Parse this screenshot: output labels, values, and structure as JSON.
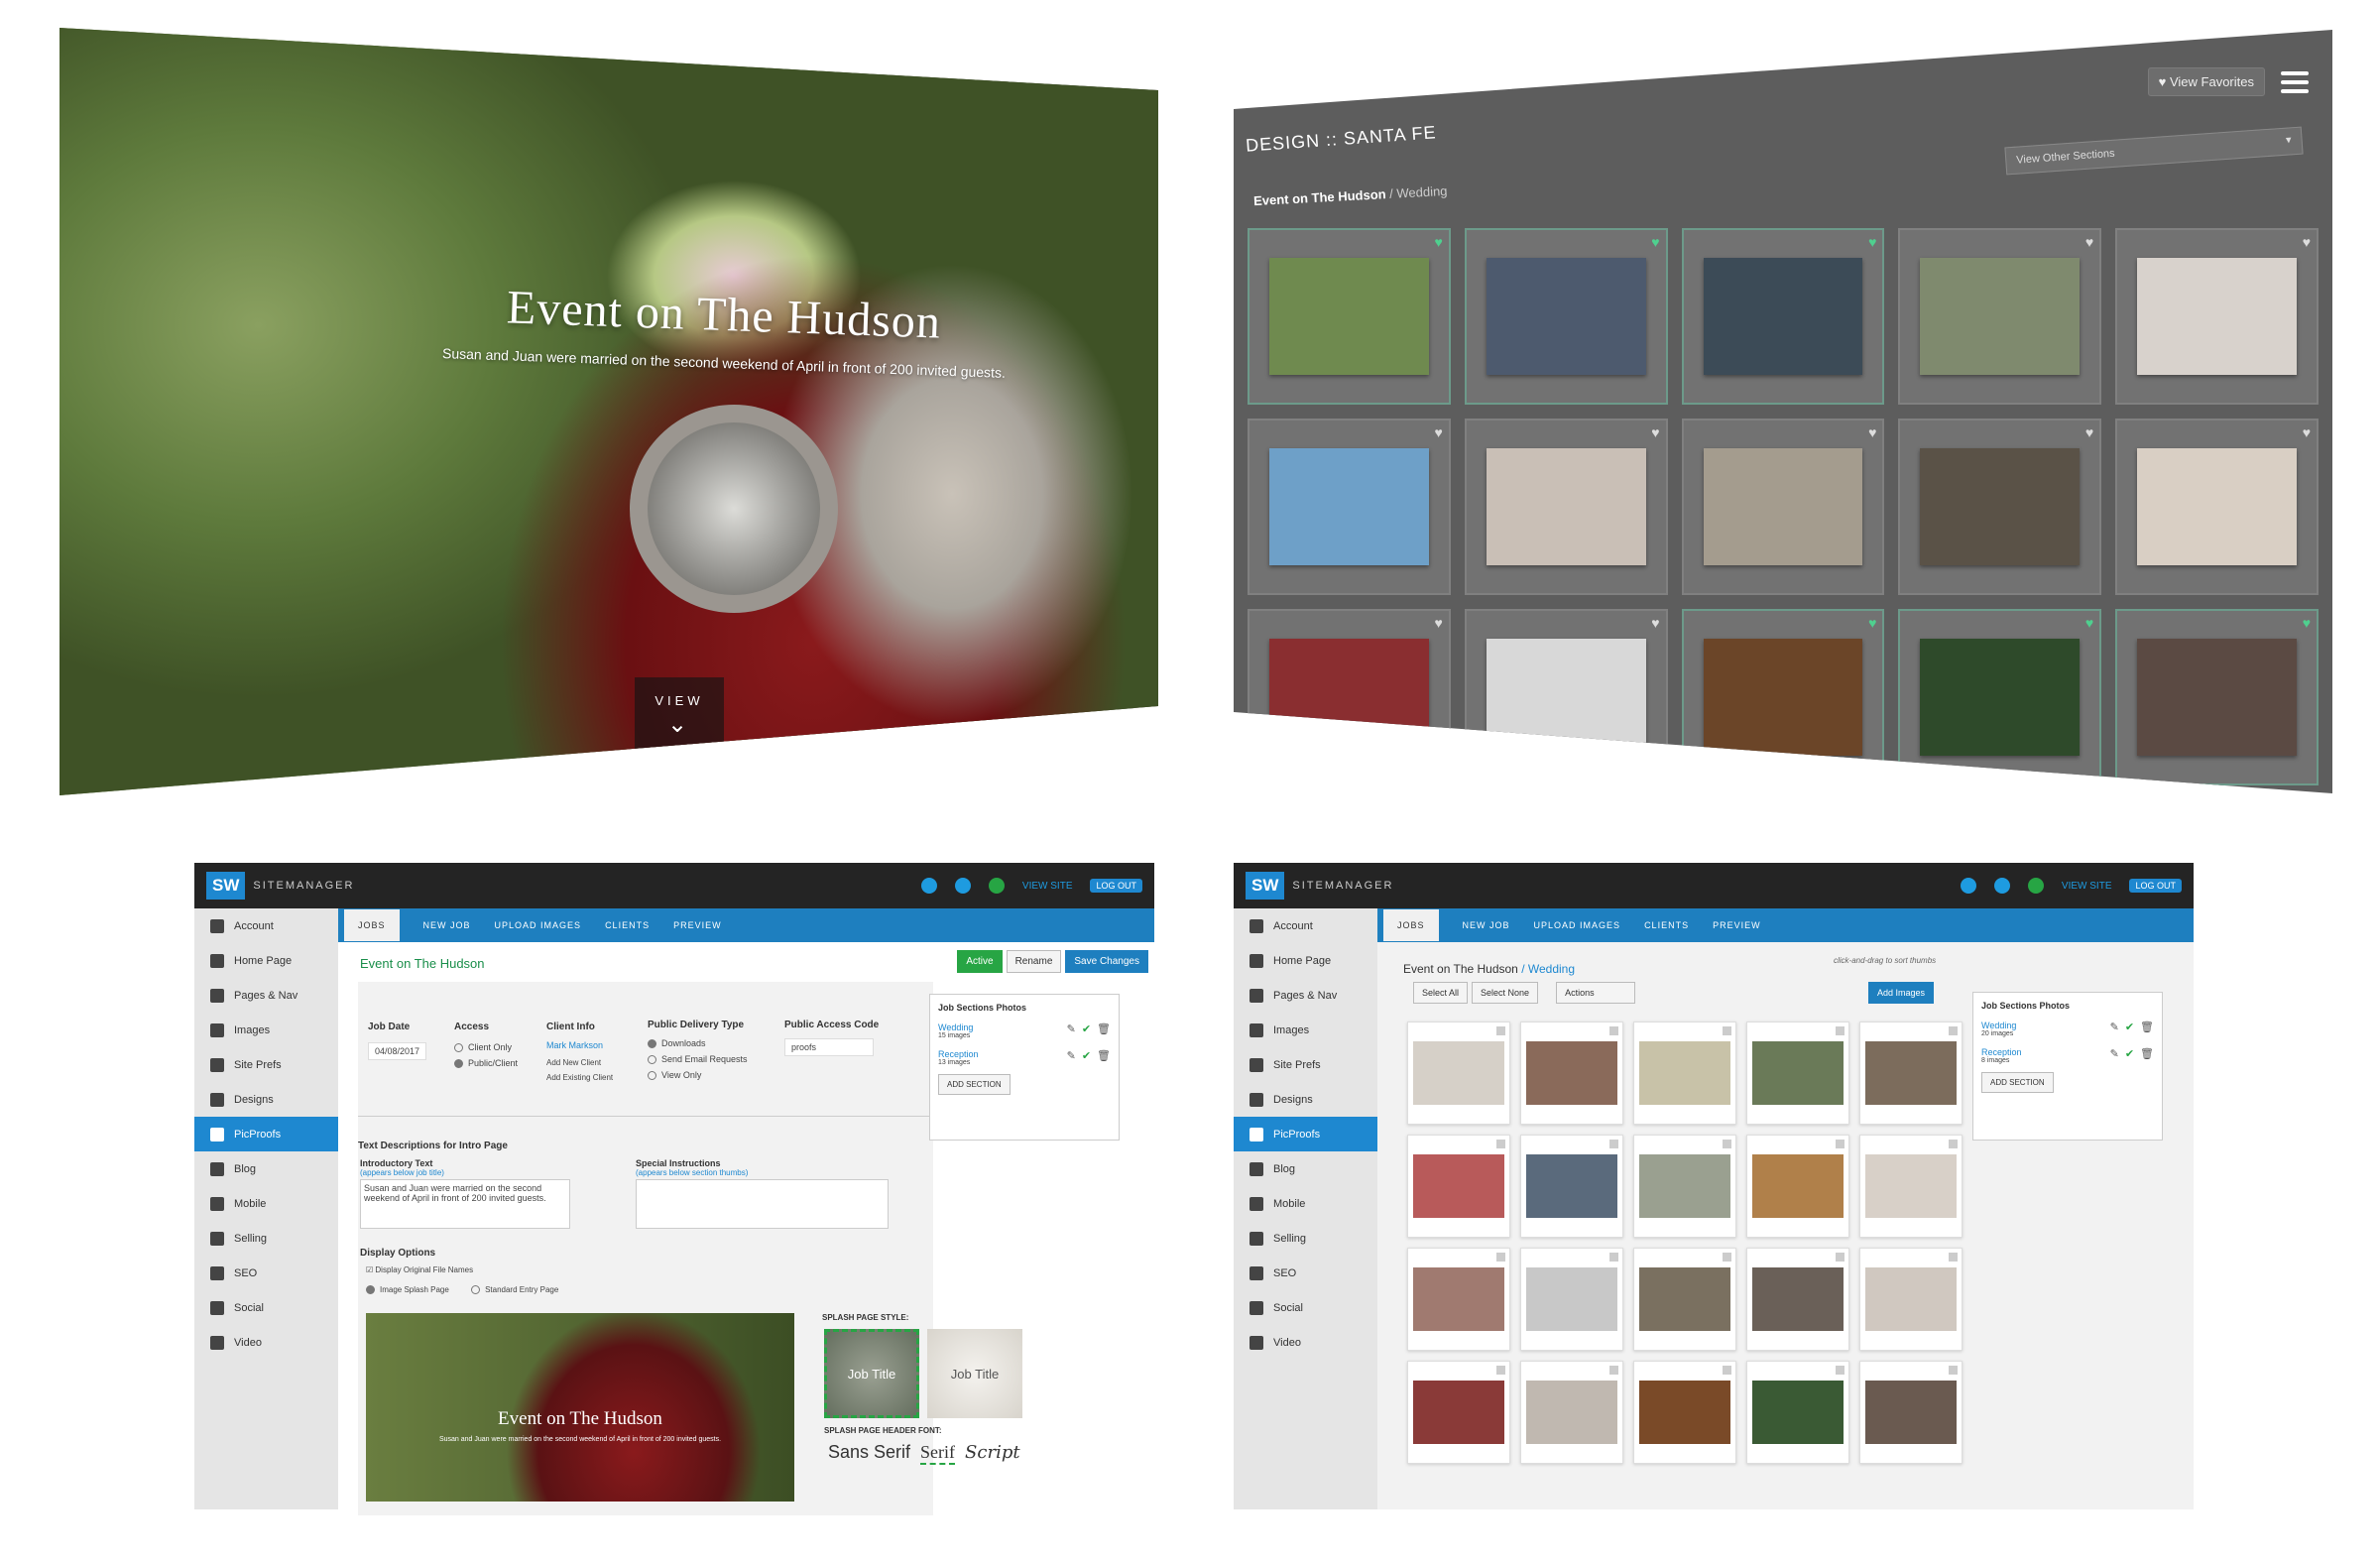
{
  "splash": {
    "title": "Event on The Hudson",
    "subtitle": "Susan and Juan were married on the second weekend of April in front of 200 invited guests.",
    "view_label": "VIEW"
  },
  "gallery": {
    "fav_label": "♥ View Favorites",
    "design_label": "DESIGN :: SANTA FE",
    "other_sections": "View Other Sections",
    "crumb_job": "Event on The Hudson",
    "crumb_section": "/ Wedding",
    "photos": [
      {
        "color": "#6f8a4f",
        "fav": true
      },
      {
        "color": "#4d5a6e",
        "fav": true
      },
      {
        "color": "#3c4b57",
        "fav": true
      },
      {
        "color": "#7f8a6e",
        "fav": false
      },
      {
        "color": "#d8d2cc",
        "fav": false
      },
      {
        "color": "#6ea0c8",
        "fav": false
      },
      {
        "color": "#c9bfb6",
        "fav": false
      },
      {
        "color": "#a49c8e",
        "fav": false
      },
      {
        "color": "#5a5247",
        "fav": false
      },
      {
        "color": "#d9cfc4",
        "fav": false
      },
      {
        "color": "#8a2e30",
        "fav": false
      },
      {
        "color": "#d8d8d8",
        "fav": false
      },
      {
        "color": "#6b4528",
        "fav": true
      },
      {
        "color": "#2e4a2a",
        "fav": true
      },
      {
        "color": "#5b4a43",
        "fav": true
      }
    ]
  },
  "admin": {
    "brand": "SITEMANAGER",
    "logo": "SW",
    "view_site": "VIEW SITE",
    "log_out": "LOG OUT",
    "sidebar": [
      "Account",
      "Home Page",
      "Pages & Nav",
      "Images",
      "Site Prefs",
      "Designs",
      "PicProofs",
      "Blog",
      "Mobile",
      "Selling",
      "SEO",
      "Social",
      "Video"
    ],
    "nav": [
      "JOBS",
      "NEW JOB",
      "UPLOAD IMAGES",
      "CLIENTS",
      "PREVIEW"
    ]
  },
  "left_admin": {
    "job_title": "Event on The Hudson",
    "active": "Active",
    "rename": "Rename",
    "save": "Save Changes",
    "job_date_label": "Job Date",
    "job_date": "04/08/2017",
    "access_label": "Access",
    "client_only": "Client Only",
    "public_client": "Public/Client",
    "client_info_label": "Client Info",
    "client_name": "Mark Markson",
    "add_new_client": "Add New Client",
    "add_existing_client": "Add Existing Client",
    "delivery_label": "Public Delivery Type",
    "downloads": "Downloads",
    "send_email": "Send Email Requests",
    "view_only": "View Only",
    "access_code_label": "Public Access Code",
    "access_code": "proofs",
    "sections_title": "Job Sections Photos",
    "sections": [
      {
        "name": "Wedding",
        "count": "15 images"
      },
      {
        "name": "Reception",
        "count": "13 images"
      }
    ],
    "add_section": "ADD SECTION",
    "text_desc": "Text Descriptions for Intro Page",
    "intro_label": "Introductory Text",
    "intro_hint": "(appears below job title)",
    "intro_text": "Susan and Juan were married on the second weekend of April in front of 200 invited guests.",
    "special_label": "Special Instructions",
    "special_hint": "(appears below section thumbs)",
    "display_opts": "Display Options",
    "display_original": "Display Original File Names",
    "image_splash": "Image Splash Page",
    "standard_entry": "Standard Entry Page",
    "preview_title": "Event on The Hudson",
    "preview_sub": "Susan and Juan were married on the second weekend of April in front of 200 invited guests.",
    "splash_style": "SPLASH PAGE STYLE:",
    "style_job_title": "Job Title",
    "style_job_title2": "Job Title",
    "font_label": "SPLASH PAGE HEADER FONT:",
    "font_sans": "Sans Serif",
    "font_serif": "Serif",
    "font_script": "Script"
  },
  "right_admin": {
    "job": "Event on The Hudson",
    "section": "/ Wedding",
    "drag_hint": "click-and-drag to sort thumbs",
    "select_all": "Select All",
    "select_none": "Select None",
    "actions": "Actions",
    "add_images": "Add Images",
    "sections_title": "Job Sections Photos",
    "sections": [
      {
        "name": "Wedding",
        "count": "20 images"
      },
      {
        "name": "Reception",
        "count": "8 images"
      }
    ],
    "add_section": "ADD SECTION",
    "thumbs": [
      "#d6d0c8",
      "#8a6a5a",
      "#c8c2a8",
      "#6a7a58",
      "#7c6c5c",
      "#b85a5a",
      "#5a6a7c",
      "#9aa090",
      "#b0804a",
      "#d8d0c8",
      "#a07a70",
      "#c8c8c8",
      "#7a7060",
      "#6a6058",
      "#d0c8c0",
      "#8a3a38",
      "#c0b8b0",
      "#7a4a28",
      "#3a5a34",
      "#6a5a50"
    ]
  }
}
